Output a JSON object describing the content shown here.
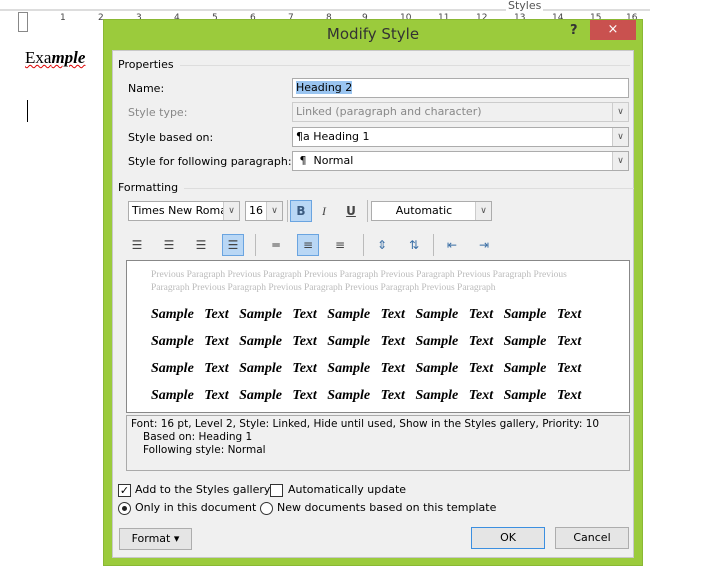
{
  "background": {
    "styles_pane_label": "Styles",
    "ruler_numbers": [
      "1",
      "2",
      "3",
      "4",
      "5",
      "6",
      "7",
      "8",
      "9",
      "10",
      "11",
      "12",
      "13",
      "14",
      "15",
      "16"
    ],
    "document_text_plain": "Exa",
    "document_text_styled": "mple"
  },
  "dialog": {
    "title": "Modify Style",
    "help_label": "?",
    "close_label": "×",
    "properties": {
      "heading": "Properties",
      "name_label": "Name:",
      "name_value": "Heading 2",
      "style_type_label": "Style type:",
      "style_type_value": "Linked (paragraph and character)",
      "based_on_label": "Style based on:",
      "based_on_icon": "¶a",
      "based_on_value": "Heading 1",
      "following_label": "Style for following paragraph:",
      "following_icon": "¶",
      "following_value": "Normal"
    },
    "formatting": {
      "heading": "Formatting",
      "font": "Times New Roman",
      "size": "16",
      "bold": "B",
      "italic": "I",
      "underline": "U",
      "color": "Automatic",
      "bold_active": true,
      "alignment": "justify",
      "line_spacing": "1.5"
    },
    "preview": {
      "previous_paragraph": "Previous Paragraph Previous Paragraph Previous Paragraph Previous Paragraph Previous Paragraph Previous Paragraph Previous Paragraph Previous Paragraph Previous Paragraph Previous Paragraph",
      "sample_lines": [
        "Sample Text Sample Text Sample Text Sample Text Sample Text",
        "Sample Text Sample Text Sample Text Sample Text Sample Text",
        "Sample Text Sample Text Sample Text Sample Text Sample Text",
        "Sample Text Sample Text Sample Text Sample Text Sample Text"
      ]
    },
    "description": {
      "line1": "Font: 16 pt, Level 2, Style: Linked, Hide until used, Show in the Styles gallery, Priority: 10",
      "line2": "Based on: Heading 1",
      "line3": "Following style: Normal"
    },
    "options": {
      "add_to_gallery": "Add to the Styles gallery",
      "add_to_gallery_checked": true,
      "auto_update": "Automatically update",
      "auto_update_checked": false,
      "only_this_doc": "Only in this document",
      "new_docs": "New documents based on this template",
      "selected_scope": "only_this_doc"
    },
    "buttons": {
      "format": "Format",
      "format_arrow": "▾",
      "ok": "OK",
      "cancel": "Cancel"
    },
    "colors": {
      "frame": "#9bcb3c",
      "close": "#c9514f",
      "selection": "#99c4f0"
    }
  }
}
